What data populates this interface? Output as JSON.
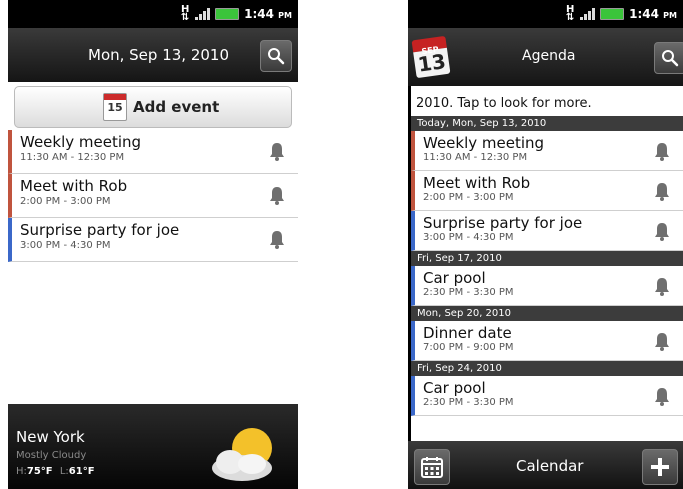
{
  "status_bar": {
    "time": "1:44",
    "ampm": "PM"
  },
  "left_screen": {
    "title": "Mon, Sep 13, 2010",
    "add_event_label": "Add event",
    "add_event_icon_day": "15",
    "events": [
      {
        "title": "Weekly meeting",
        "time": "11:30 AM - 12:30 PM",
        "color": "#c0543e"
      },
      {
        "title": "Meet with Rob",
        "time": "2:00 PM - 3:00 PM",
        "color": "#c0543e"
      },
      {
        "title": "Surprise party for joe",
        "time": "3:00 PM - 4:30 PM",
        "color": "#3b68c9"
      }
    ],
    "weather": {
      "city": "New York",
      "condition": "Mostly Cloudy",
      "high_label": "H:",
      "high": "75°F",
      "low_label": "L:",
      "low": "61°F"
    }
  },
  "right_screen": {
    "title": "Agenda",
    "logo_month": "SEP",
    "logo_day": "13",
    "top_partial_text": "2010. Tap to look for more.",
    "groups": [
      {
        "date": "Today, Mon, Sep 13, 2010",
        "events": [
          {
            "title": "Weekly meeting",
            "time": "11:30 AM - 12:30 PM",
            "color": "#c0543e"
          },
          {
            "title": "Meet with Rob",
            "time": "2:00 PM - 3:00 PM",
            "color": "#c0543e"
          },
          {
            "title": "Surprise party for joe",
            "time": "3:00 PM - 4:30 PM",
            "color": "#3b68c9"
          }
        ]
      },
      {
        "date": "Fri, Sep 17, 2010",
        "events": [
          {
            "title": "Car pool",
            "time": "2:30 PM - 3:30 PM",
            "color": "#3b68c9"
          }
        ]
      },
      {
        "date": "Mon, Sep 20, 2010",
        "events": [
          {
            "title": "Dinner date",
            "time": "7:00 PM - 9:00 PM",
            "color": "#3b68c9"
          }
        ]
      },
      {
        "date": "Fri, Sep 24, 2010",
        "events": [
          {
            "title": "Car pool",
            "time": "2:30 PM - 3:30 PM",
            "color": "#3b68c9"
          }
        ]
      }
    ],
    "bottom_label": "Calendar"
  }
}
